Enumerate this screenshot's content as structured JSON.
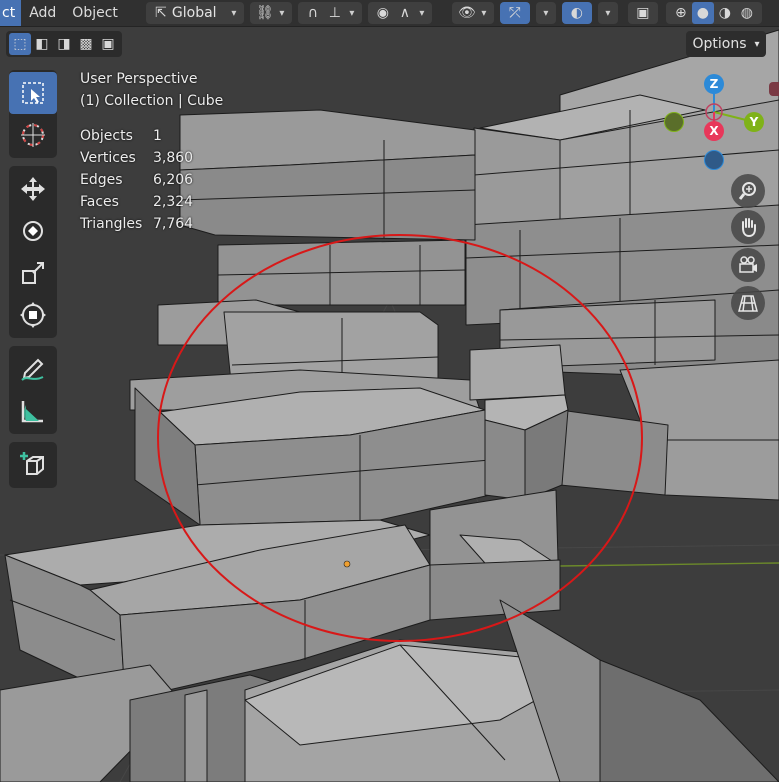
{
  "header": {
    "menu": [
      "ct",
      "Add",
      "Object"
    ],
    "orientation": "Global"
  },
  "options_label": "Options",
  "overlay": {
    "perspective": "User Perspective",
    "collection": "(1) Collection | Cube"
  },
  "stats": [
    {
      "label": "Objects",
      "value": "1"
    },
    {
      "label": "Vertices",
      "value": "3,860"
    },
    {
      "label": "Edges",
      "value": "6,206"
    },
    {
      "label": "Faces",
      "value": "2,324"
    },
    {
      "label": "Triangles",
      "value": "7,764"
    }
  ],
  "gizmo": {
    "z": "Z",
    "x": "X",
    "y": "Y"
  },
  "colors": {
    "accent": "#4772b3",
    "viewport_bg": "#3d3d3d",
    "mesh_top": "#a8a8a8",
    "annotation": "#d81818",
    "axis_x": "#e8375a",
    "axis_y": "#7fb218",
    "axis_z": "#2c8ad8"
  },
  "toolbar_tools": [
    "select-box",
    "cursor",
    "move",
    "rotate",
    "scale",
    "transform",
    "annotate",
    "measure",
    "add-cube"
  ],
  "nav_buttons": [
    "zoom",
    "pan",
    "camera",
    "perspective-grid"
  ]
}
